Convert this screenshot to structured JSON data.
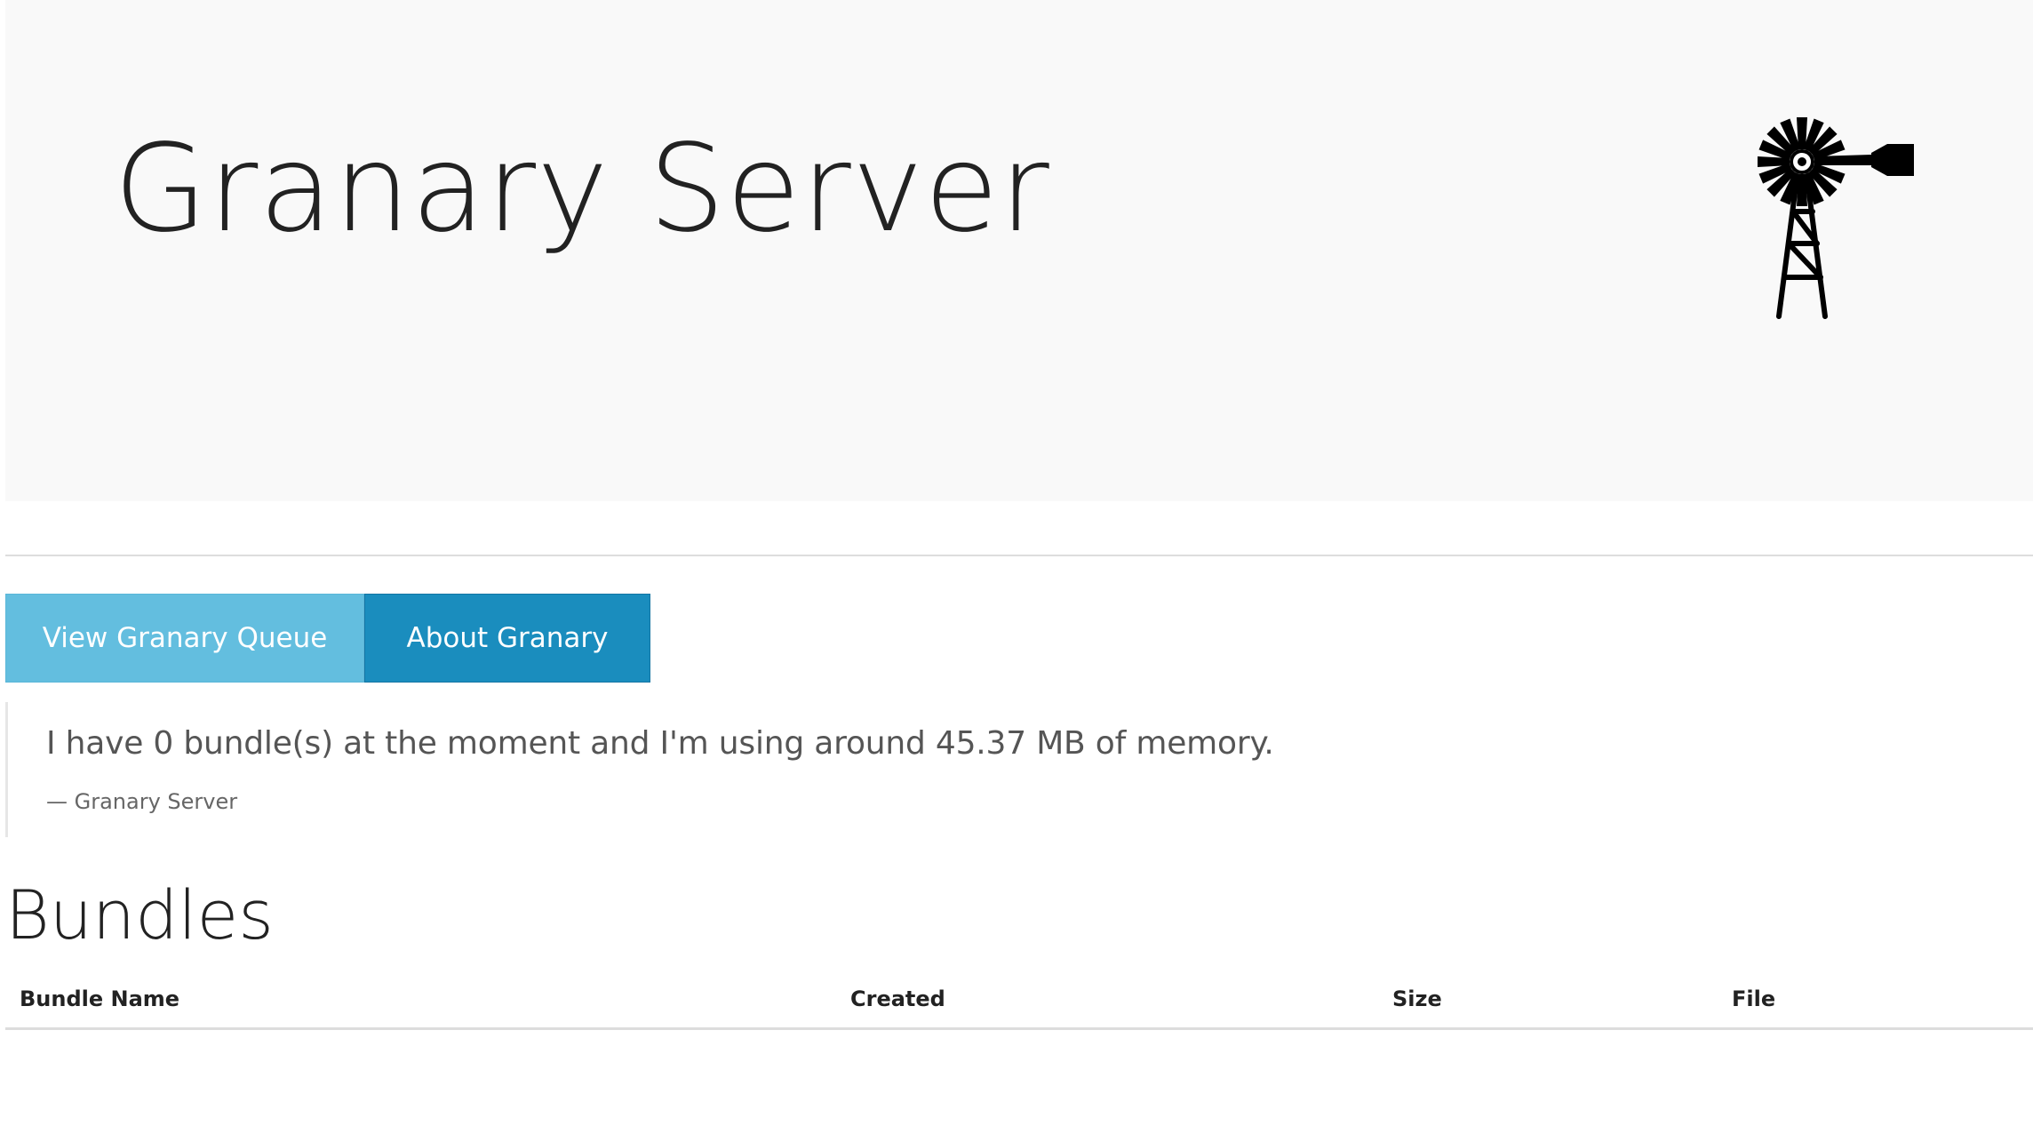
{
  "header": {
    "title": "Granary Server",
    "logo_icon": "windmill-icon"
  },
  "nav": {
    "queue_label": "View Granary Queue",
    "about_label": "About Granary"
  },
  "status": {
    "message": "I have 0 bundle(s) at the moment and I'm using around 45.37 MB of memory.",
    "attribution": "— Granary Server"
  },
  "bundles": {
    "title": "Bundles",
    "columns": [
      "Bundle Name",
      "Created",
      "Size",
      "File"
    ],
    "rows": []
  },
  "colors": {
    "header_bg": "#f9f9f9",
    "queue_button": "#63bedf",
    "about_button": "#1a8dbe"
  }
}
